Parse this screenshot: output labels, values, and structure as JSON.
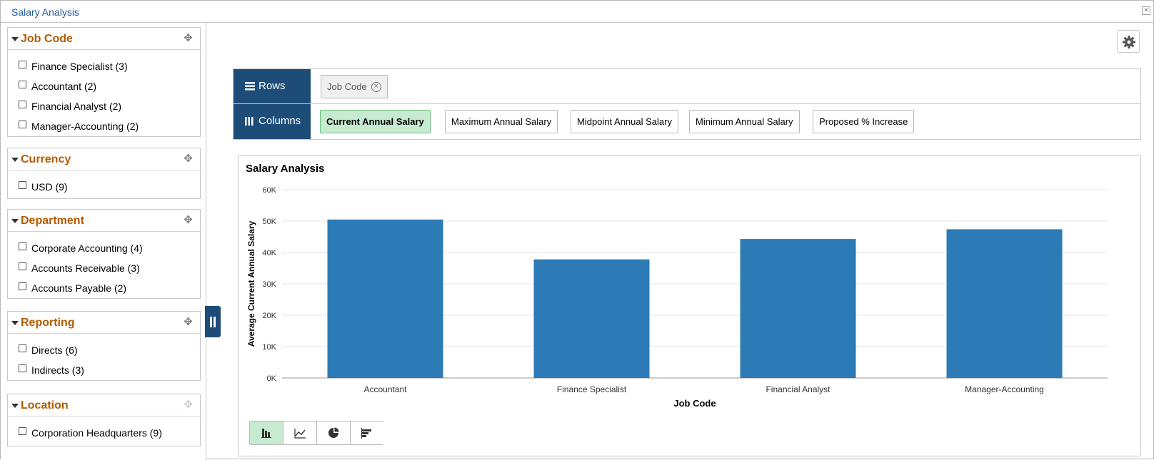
{
  "window": {
    "title": "Salary Analysis",
    "close_icon": "close-icon"
  },
  "facets": [
    {
      "title": "Job Code",
      "items": [
        "Finance Specialist (3)",
        "Accountant (2)",
        "Financial Analyst (2)",
        "Manager-Accounting (2)"
      ]
    },
    {
      "title": "Currency",
      "items": [
        "USD (9)"
      ]
    },
    {
      "title": "Department",
      "items": [
        "Corporate Accounting (4)",
        "Accounts Receivable (3)",
        "Accounts Payable (2)"
      ]
    },
    {
      "title": "Reporting",
      "items": [
        "Directs (6)",
        "Indirects (3)"
      ]
    },
    {
      "title": "Location",
      "items": [
        "Corporation Headquarters (9)"
      ]
    }
  ],
  "pivot": {
    "rows_label": "Rows",
    "rows_chips": [
      "Job Code"
    ],
    "columns_label": "Columns",
    "columns_chips": [
      "Current Annual Salary",
      "Maximum Annual Salary",
      "Midpoint Annual Salary",
      "Minimum Annual Salary",
      "Proposed % Increase"
    ],
    "active_column": "Current Annual Salary"
  },
  "chart_type_buttons": [
    "bar-chart-icon",
    "line-chart-icon",
    "pie-chart-icon",
    "horizontal-bar-icon"
  ],
  "colors": {
    "bar": "#2c7bb6",
    "accent": "#1e4c79",
    "facet_title": "#b35a00",
    "active_chip": "#c7ebd0"
  },
  "chart_data": {
    "type": "bar",
    "title": "Salary Analysis",
    "xlabel": "Job Code",
    "ylabel": "Average Current Annual Salary",
    "categories": [
      "Accountant",
      "Finance Specialist",
      "Financial Analyst",
      "Manager-Accounting"
    ],
    "values": [
      50500,
      37800,
      44300,
      47400
    ],
    "ylim": [
      0,
      60000
    ],
    "yticks": [
      "0K",
      "10K",
      "20K",
      "30K",
      "40K",
      "50K",
      "60K"
    ],
    "grid": true
  }
}
